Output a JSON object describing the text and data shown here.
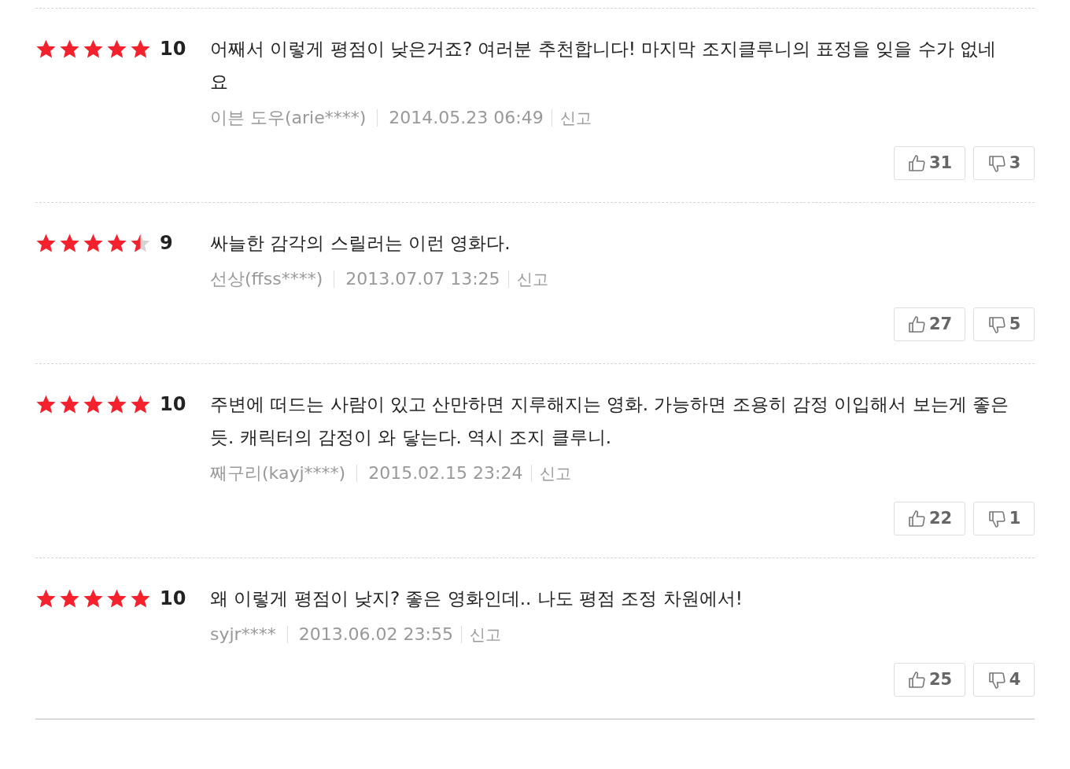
{
  "reviews": [
    {
      "stars": 5,
      "score": "10",
      "text": "어째서 이렇게 평점이 낮은거죠? 여러분 추천합니다! 마지막 조지클루니의 표정을 잊을 수가 없네요",
      "author": "이븐 도우(arie****)",
      "date": "2014.05.23 06:49",
      "report": "신고",
      "likes": "31",
      "dislikes": "3"
    },
    {
      "stars": 4.5,
      "score": "9",
      "text": "싸늘한 감각의 스릴러는 이런 영화다.",
      "author": "선상(ffss****)",
      "date": "2013.07.07 13:25",
      "report": "신고",
      "likes": "27",
      "dislikes": "5"
    },
    {
      "stars": 5,
      "score": "10",
      "text": "주변에 떠드는 사람이 있고 산만하면 지루해지는 영화. 가능하면 조용히 감정 이입해서 보는게 좋은듯. 캐릭터의 감정이 와 닿는다. 역시 조지 클루니.",
      "author": "째구리(kayj****)",
      "date": "2015.02.15 23:24",
      "report": "신고",
      "likes": "22",
      "dislikes": "1"
    },
    {
      "stars": 5,
      "score": "10",
      "text": "왜 이렇게 평점이 낮지? 좋은 영화인데.. 나도 평점 조정 차원에서!",
      "author": "syjr****",
      "date": "2013.06.02 23:55",
      "report": "신고",
      "likes": "25",
      "dislikes": "4"
    }
  ]
}
